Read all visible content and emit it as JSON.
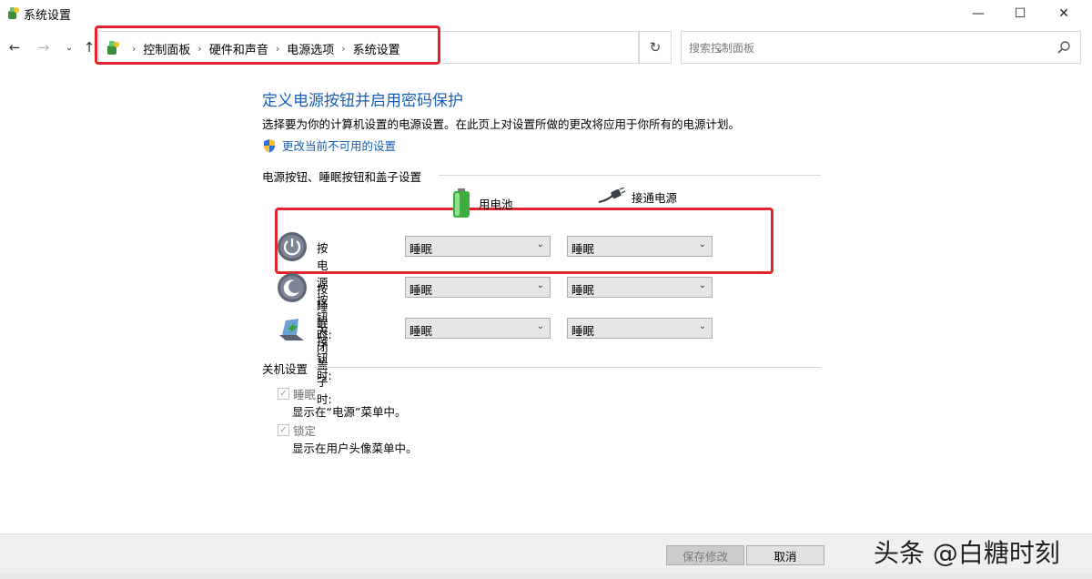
{
  "window": {
    "title": "系统设置",
    "minimize_glyph": "—",
    "maximize_glyph": "☐",
    "close_glyph": "✕"
  },
  "nav": {
    "back_glyph": "←",
    "forward_glyph": "→",
    "recent_glyph": "⌄",
    "up_glyph": "↑",
    "breadcrumbs": [
      "控制面板",
      "硬件和声音",
      "电源选项",
      "系统设置"
    ],
    "separator": "›",
    "dropdown_glyph": "⌄",
    "refresh_glyph": "↻",
    "search_placeholder": "搜索控制面板"
  },
  "main": {
    "title": "定义电源按钮并启用密码保护",
    "description": "选择要为你的计算机设置的电源设置。在此页上对设置所做的更改将应用于你所有的电源计划。",
    "change_link": "更改当前不可用的设置",
    "power_group": {
      "heading": "电源按钮、睡眠按钮和盖子设置",
      "col_battery": "用电池",
      "col_plugged": "接通电源",
      "rows": [
        {
          "label": "按电源按钮时:",
          "battery": "睡眠",
          "plugged": "睡眠"
        },
        {
          "label": "按睡眠按钮时:",
          "battery": "睡眠",
          "plugged": "睡眠"
        },
        {
          "label": "关闭盖子时:",
          "battery": "睡眠",
          "plugged": "睡眠"
        }
      ]
    },
    "shutdown_group": {
      "heading": "关机设置",
      "items": [
        {
          "label": "睡眠",
          "desc": "显示在“电源”菜单中。",
          "checked": true
        },
        {
          "label": "锁定",
          "desc": "显示在用户头像菜单中。",
          "checked": true
        }
      ]
    }
  },
  "footer": {
    "save_label": "保存修改",
    "cancel_label": "取消"
  },
  "watermark": "头条 @白糖时刻",
  "colors": {
    "link": "#1a5fb4",
    "highlight": "#e0262b"
  }
}
